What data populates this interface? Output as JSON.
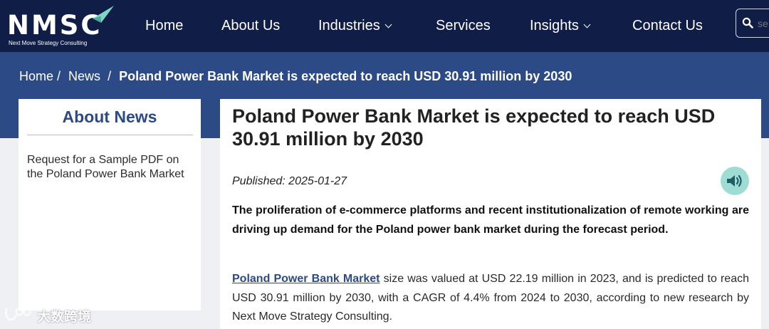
{
  "brand": {
    "logo_text": "NMSC",
    "tagline": "Next Move Strategy Consulting",
    "accent_color": "#7fd6c6",
    "nav_bg": "#0f1d47",
    "hero_bg": "#2b4a86"
  },
  "nav": {
    "items": [
      {
        "label": "Home",
        "dropdown": false
      },
      {
        "label": "About Us",
        "dropdown": false
      },
      {
        "label": "Industries",
        "dropdown": true
      },
      {
        "label": "Services",
        "dropdown": false
      },
      {
        "label": "Insights",
        "dropdown": true
      },
      {
        "label": "Contact Us",
        "dropdown": false
      }
    ],
    "search": {
      "placeholder": "se",
      "icon": "search-icon"
    }
  },
  "breadcrumb": {
    "items": [
      "Home",
      "News"
    ],
    "separator": "/",
    "current": "Poland Power Bank Market is expected to reach USD 30.91 million by 2030"
  },
  "sidebar": {
    "title": "About News",
    "link": "Request for a Sample PDF on the Poland Power Bank Market"
  },
  "article": {
    "title": "Poland Power Bank Market is expected to reach USD 30.91 million by 2030",
    "published": "Published: 2025-01-27",
    "audio_icon": "speaker-icon",
    "lead": "The proliferation of e-commerce platforms and recent institutionalization of remote working are driving up demand for the Poland power bank market during the forecast period.",
    "body_link": "Poland Power Bank Market",
    "body_rest": " size was valued at USD 22.19 million in 2023, and is predicted to reach USD 30.91 million by 2030, with a CAGR of 4.4% from 2024 to 2030, according to new research by Next Move Strategy Consulting."
  },
  "watermark": {
    "text": "大数跨境",
    "icon": "watermark-logo-icon"
  }
}
